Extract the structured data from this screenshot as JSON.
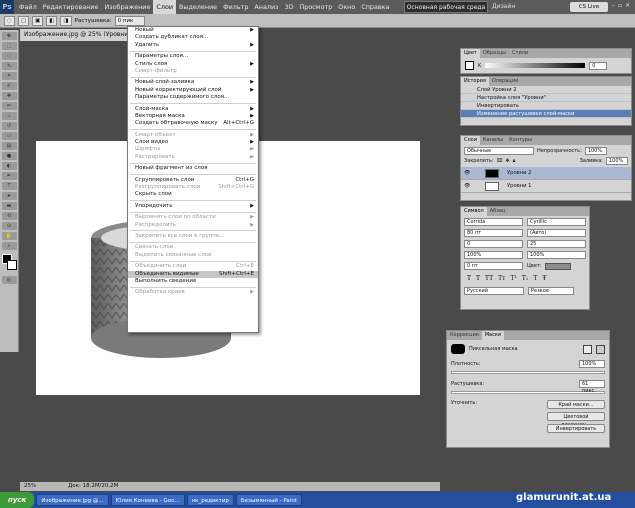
{
  "app": {
    "logo": "Ps"
  },
  "menubar": {
    "items": [
      {
        "label": "Файл",
        "active": false
      },
      {
        "label": "Редактирование",
        "active": false
      },
      {
        "label": "Изображение",
        "active": false
      },
      {
        "label": "Слои",
        "active": true
      },
      {
        "label": "Выделение",
        "active": false
      },
      {
        "label": "Фильтр",
        "active": false
      },
      {
        "label": "Анализ",
        "active": false
      },
      {
        "label": "3D",
        "active": false
      },
      {
        "label": "Просмотр",
        "active": false
      },
      {
        "label": "Окно",
        "active": false
      },
      {
        "label": "Справка",
        "active": false
      }
    ],
    "zoom": "25%",
    "workspace": "Основная рабочая среда",
    "design": "Дизайн",
    "cslive": "CS Live"
  },
  "options": {
    "feather_label": "Растушевка:",
    "feather_value": "0 пик"
  },
  "document": {
    "tab_title": "Изображение.jpg @ 25% (Уровни 2...",
    "status_zoom": "25%",
    "status_doc": "Док: 18,2M/20,2M"
  },
  "layer_menu": {
    "items": [
      {
        "label": "Новый",
        "shortcut": "",
        "sub": true,
        "disabled": false
      },
      {
        "label": "Создать дубликат слоя...",
        "shortcut": "",
        "sub": false,
        "disabled": false
      },
      {
        "label": "Удалить",
        "shortcut": "",
        "sub": true,
        "disabled": false
      },
      {
        "sep": true
      },
      {
        "label": "Параметры слоя...",
        "shortcut": "",
        "sub": false,
        "disabled": false
      },
      {
        "label": "Стиль слоя",
        "shortcut": "",
        "sub": true,
        "disabled": false
      },
      {
        "label": "Смарт-фильтр",
        "shortcut": "",
        "sub": false,
        "disabled": true
      },
      {
        "sep": true
      },
      {
        "label": "Новый слой-заливка",
        "shortcut": "",
        "sub": true,
        "disabled": false
      },
      {
        "label": "Новый корректирующий слой",
        "shortcut": "",
        "sub": true,
        "disabled": false
      },
      {
        "label": "Параметры содержимого слоя...",
        "shortcut": "",
        "sub": false,
        "disabled": false
      },
      {
        "sep": true
      },
      {
        "label": "Слой-маска",
        "shortcut": "",
        "sub": true,
        "disabled": false
      },
      {
        "label": "Векторная маска",
        "shortcut": "",
        "sub": true,
        "disabled": false
      },
      {
        "label": "Создать обтравочную маску",
        "shortcut": "Alt+Ctrl+G",
        "sub": false,
        "disabled": false
      },
      {
        "sep": true
      },
      {
        "label": "Смарт-объект",
        "shortcut": "",
        "sub": true,
        "disabled": true
      },
      {
        "label": "Слои видео",
        "shortcut": "",
        "sub": true,
        "disabled": false
      },
      {
        "label": "Шрифты",
        "shortcut": "",
        "sub": true,
        "disabled": true
      },
      {
        "label": "Растрировать",
        "shortcut": "",
        "sub": true,
        "disabled": true
      },
      {
        "sep": true
      },
      {
        "label": "Новый фрагмент из слоя",
        "shortcut": "",
        "sub": false,
        "disabled": false
      },
      {
        "sep": true
      },
      {
        "label": "Сгруппировать слои",
        "shortcut": "Ctrl+G",
        "sub": false,
        "disabled": false
      },
      {
        "label": "Разгруппировать слои",
        "shortcut": "Shift+Ctrl+G",
        "sub": false,
        "disabled": true
      },
      {
        "label": "Скрыть слои",
        "shortcut": "",
        "sub": false,
        "disabled": false
      },
      {
        "sep": true
      },
      {
        "label": "Упорядочить",
        "shortcut": "",
        "sub": true,
        "disabled": false
      },
      {
        "sep": true
      },
      {
        "label": "Выровнять слои по области",
        "shortcut": "",
        "sub": true,
        "disabled": true
      },
      {
        "label": "Распределить",
        "shortcut": "",
        "sub": true,
        "disabled": true
      },
      {
        "sep": true
      },
      {
        "label": "Закрепить все слои в группе...",
        "shortcut": "",
        "sub": false,
        "disabled": true
      },
      {
        "sep": true
      },
      {
        "label": "Связать слои",
        "shortcut": "",
        "sub": false,
        "disabled": true
      },
      {
        "label": "Выделить связанные слои",
        "shortcut": "",
        "sub": false,
        "disabled": true
      },
      {
        "sep": true
      },
      {
        "label": "Объединить слои",
        "shortcut": "Ctrl+E",
        "sub": false,
        "disabled": true
      },
      {
        "label": "Объединить видимые",
        "shortcut": "Shift+Ctrl+E",
        "sub": false,
        "disabled": false,
        "highlight": true
      },
      {
        "label": "Выполнить сведение",
        "shortcut": "",
        "sub": false,
        "disabled": false
      },
      {
        "sep": true
      },
      {
        "label": "Обработка краев",
        "shortcut": "",
        "sub": true,
        "disabled": true
      }
    ]
  },
  "color_panel": {
    "tabs": [
      "Цвет",
      "Образцы",
      "Стили"
    ],
    "channel": "K",
    "value": "0"
  },
  "history_panel": {
    "tabs": [
      "История",
      "Операции"
    ],
    "rows": [
      {
        "label": "Слой Уровни 2",
        "selected": false
      },
      {
        "label": "Настройка слоя \"Уровни\"",
        "selected": false
      },
      {
        "label": "Инвертировать",
        "selected": false
      },
      {
        "label": "Изменение растушевки слой-маски",
        "selected": true
      }
    ]
  },
  "layers_panel": {
    "tabs": [
      "Слои",
      "Каналы",
      "Контуры"
    ],
    "blend_mode": "Обычные",
    "opacity_label": "Непрозрачность:",
    "opacity_value": "100%",
    "lock_label": "Закрепить:",
    "fill_label": "Заливка:",
    "fill_value": "100%",
    "layers": [
      {
        "name": "Уровни 2",
        "selected": true
      },
      {
        "name": "Уровни 1",
        "selected": false
      }
    ]
  },
  "character_panel": {
    "tabs": [
      "Символ",
      "Абзац"
    ],
    "font": "Corrida",
    "style": "Cyrillic",
    "size": "80 пт",
    "leading": "(Авто)",
    "kerning": "0",
    "tracking": "25",
    "vscale": "100%",
    "hscale": "100%",
    "baseline": "0 пт",
    "color_label": "Цвет:",
    "language": "Русский",
    "antialias": "Резкое",
    "type_buttons": [
      "T",
      "T",
      "TT",
      "Tт",
      "T¹",
      "T₁",
      "T",
      "Ŧ"
    ]
  },
  "masks_panel": {
    "tabs": [
      "Коррекция",
      "Маски"
    ],
    "mask_label": "Пиксельная маска",
    "density_label": "Плотность:",
    "density_value": "100%",
    "feather_label": "Растушевка:",
    "feather_value": "61 пикс.",
    "refine_label": "Уточнить:",
    "buttons": [
      "Край маски...",
      "Цветовой диапазон...",
      "Инвертировать"
    ]
  },
  "taskbar": {
    "start": "пуск",
    "tasks": [
      "Изображение.jpg @...",
      "Юлия Конеева - Goo...",
      "нк_редактир",
      "Безымянный - Paint"
    ]
  },
  "watermark": "glamurunit.at.ua",
  "colors": {
    "menubar": "#5b5b5b",
    "workspace": "#4a4a4a",
    "taskbar": "#234f9e",
    "selected": "#5a7fb8"
  }
}
